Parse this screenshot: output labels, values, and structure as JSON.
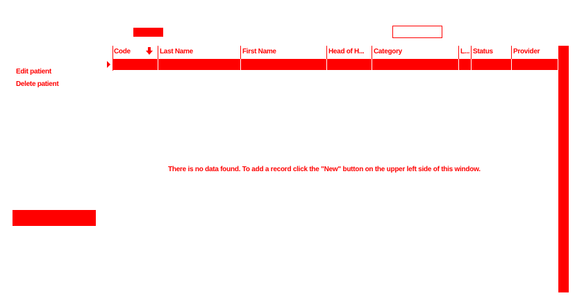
{
  "toolbar": {
    "button_label": "",
    "input_value": ""
  },
  "actions": {
    "edit_label": "Edit patient",
    "delete_label": "Delete patient"
  },
  "grid": {
    "columns": [
      {
        "id": "code",
        "label": "Code"
      },
      {
        "id": "last_name",
        "label": "Last Name"
      },
      {
        "id": "first_name",
        "label": "First Name"
      },
      {
        "id": "head_of_household",
        "label": "Head of H..."
      },
      {
        "id": "category",
        "label": "Category"
      },
      {
        "id": "l",
        "label": "L..."
      },
      {
        "id": "status",
        "label": "Status"
      },
      {
        "id": "provider",
        "label": "Provider"
      }
    ],
    "sort": {
      "column": "code",
      "direction": "descending"
    },
    "rows": [
      {
        "code": "",
        "last_name": "",
        "first_name": "",
        "head_of_household": "",
        "category": "",
        "l": "",
        "status": "",
        "provider": ""
      }
    ],
    "empty_message": "There is no data found.  To add a record click the \"New\" button on the upper left side of this window."
  },
  "colors": {
    "accent": "#ff0000",
    "background": "#ffffff"
  },
  "icons": {
    "sort": "arrow-down-icon",
    "row_indicator": "triangle-right-icon"
  }
}
